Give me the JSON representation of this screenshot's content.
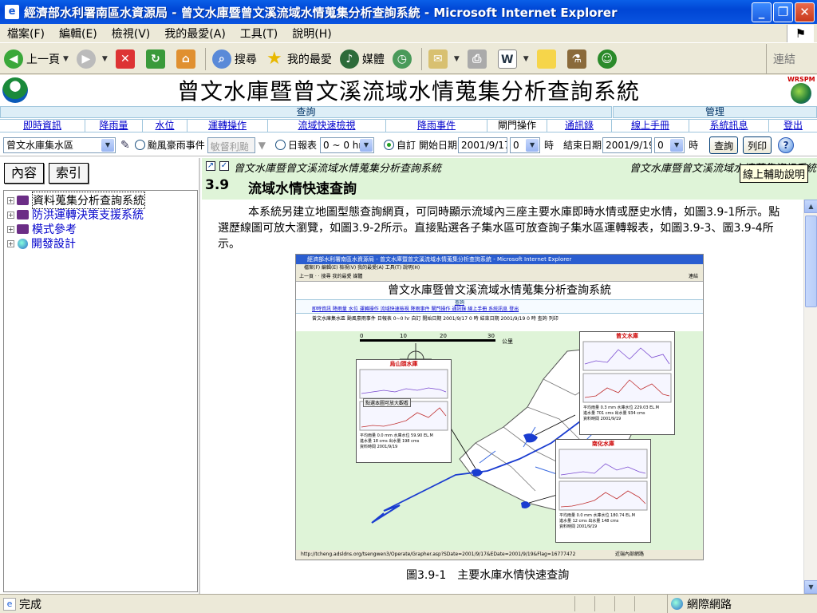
{
  "window": {
    "title": "經濟部水利署南區水資源局 - 曾文水庫暨曾文溪流域水情蒐集分析查詢系統 - Microsoft Internet Explorer"
  },
  "menu": [
    "檔案(F)",
    "編輯(E)",
    "檢視(V)",
    "我的最愛(A)",
    "工具(T)",
    "說明(H)"
  ],
  "toolbar": {
    "back": "上一頁",
    "search": "搜尋",
    "favorites": "我的最愛",
    "media": "媒體",
    "links": "連結"
  },
  "site": {
    "title": "曾文水庫暨曾文溪流域水情蒐集分析查詢系統",
    "brand": "WRSPM"
  },
  "nav": {
    "group_query": "查詢",
    "group_manage": "管理",
    "items": [
      "即時資訊",
      "降雨量",
      "水位",
      "運轉操作",
      "流域快速檢視",
      "降雨事件",
      "閘門操作",
      "通訊錄",
      "線上手冊",
      "系統訊息",
      "登出"
    ]
  },
  "query": {
    "basin_select": "曾文水庫集水區",
    "typhoon_label": "颱風豪雨事件",
    "typhoon_value": "敏督利颱",
    "daily_label": "日報表",
    "daily_select": "0 ~ 0 hr",
    "custom_label": "自訂",
    "start_label": "開始日期",
    "start_date": "2001/9/17",
    "start_hour": "0",
    "hour_unit": "時",
    "end_label": "結束日期",
    "end_date": "2001/9/19",
    "end_hour": "0",
    "query_button": "查詢",
    "print_button": "列印"
  },
  "left": {
    "tab_contents": "內容",
    "tab_index": "索引",
    "tree": [
      "資料蒐集分析查詢系統",
      "防洪運轉決策支援系統",
      "模式參考",
      "開發設計"
    ]
  },
  "doc": {
    "breadcrumb": "曾文水庫暨曾文溪流域水情蒐集分析查詢系統",
    "breadcrumb_right": "曾文水庫暨曾文溪流域水情蒐集資訊系統",
    "tooltip": "線上輔助說明",
    "section_number": "3.9",
    "section_title": "流域水情快速查詢",
    "paragraph": "本系統另建立地圖型態查詢網頁，可同時顯示流域內三座主要水庫即時水情或歷史水情，如圖3.9-1所示。點選歷線圖可放大瀏覽，如圖3.9-2所示。直接點選各子集水區可放查詢子集水區運轉報表，如圖3.9-3、圖3.9-4所示。",
    "caption": "圖3.9-1　主要水庫水情快速查詢"
  },
  "figure": {
    "win_title": "經濟部水利署南區水資源局 - 曾文水庫暨曾文溪流域水情蒐集分析查詢系統 - Microsoft Internet Explorer",
    "menu": "檔案(F)  編輯(E)  檢視(V)  我的最愛(A)  工具(T)  說明(H)",
    "toolbar": "上一頁 · · 搜尋  我的最愛  媒體",
    "links": "連結",
    "title": "曾文水庫暨曾文溪流域水情蒐集分析查詢系統",
    "nav": "即時資訊  降雨量  水位  運轉操作  流域快速檢視  降雨事件  閘門操作  通訊錄  線上手冊  系統訊息  登出",
    "query": "曾文水庫集水區  颱風豪雨事件  日報表 0~0 hr  自訂 開始日期 2001/9/17  0  時 結束日期 2001/9/19  0  時  查詢  列印",
    "scale_label": "公里",
    "scale_ticks": [
      "0",
      "10",
      "20",
      "30"
    ],
    "panels": [
      {
        "name": "曾文水庫",
        "r1": "平均雨量  0.3 mm  水庫水位  229.03 EL.M",
        "r2": "進水量  701 cms  出水量  934 cms",
        "r3": "資料時間  2001/9/19"
      },
      {
        "name": "烏山頭水庫",
        "r1": "平均雨量  0.0 mm  水庫水位  59.90 EL.M",
        "r2": "進水量  18 cms  出水量  198 cms",
        "r3": "資料時間  2001/9/19"
      },
      {
        "name": "南化水庫",
        "r1": "平均雨量  0.0 mm  水庫水位  180.74 EL.M",
        "r2": "進水量  12 cms  出水量  148 cms",
        "r3": "資料時間  2001/9/19"
      }
    ],
    "hint": "點選本圖可放大觀看",
    "status": "http://tcheng.adsldns.org/tsengwen3/Operate/Grapher.asp?SDate=2001/9/17&EDate=2001/9/19&Flag=16777472",
    "zone": "近端內部網路"
  },
  "status": {
    "text": "完成",
    "zone": "網際網路"
  }
}
